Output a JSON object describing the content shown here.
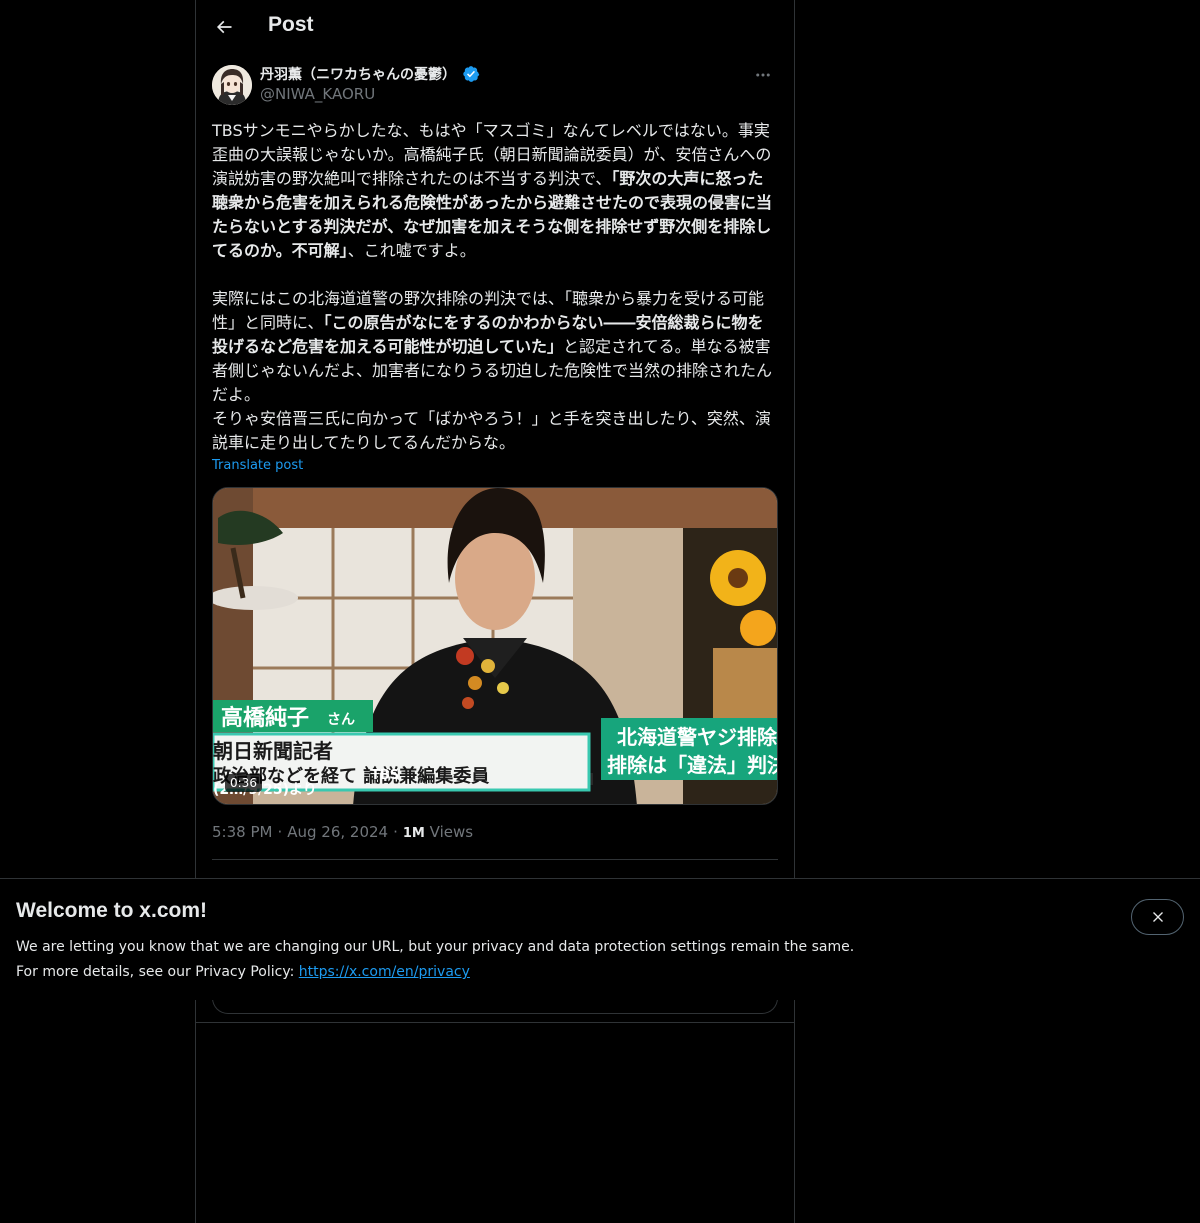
{
  "header": {
    "title": "Post"
  },
  "post": {
    "author": {
      "display_name": "丹羽薫（ニワカちゃんの憂鬱）",
      "handle": "@NIWA_KAORU"
    },
    "text_segments": [
      {
        "text": "TBSサンモニやらかしたな、もはや「マスゴミ」なんてレベルではない。事実歪曲の大誤報じゃないか。高橋純子氏（朝日新聞論説委員）が、安倍さんへの演説妨害の野次絶叫で排除されたのは不当する判決で、",
        "bold": false
      },
      {
        "text": "「野次の大声に怒った聴衆から危害を加えられる危険性があったから避難させたので表現の侵害に当たらないとする判決だが、なぜ加害を加えそうな側を排除せず野次側を排除してるのか。不可解」",
        "bold": true
      },
      {
        "text": "、これ嘘ですよ。\n\n実際にはこの北海道道警の野次排除の判決では、「聴衆から暴力を受ける可能性」と同時に、",
        "bold": false
      },
      {
        "text": "「この原告がなにをするのかわからない――安倍総裁らに物を投げるなど危害を加える可能性が切迫していた」",
        "bold": true
      },
      {
        "text": "と認定されてる。単なる被害者側じゃないんだよ、加害者になりうる切迫した危険性で当然の排除されたんだよ。\nそりゃ安倍晋三氏に向かって「ばかやろう！」と手を突き出したり、突然、演説車に走り出してたりしてるんだからな。",
        "bold": false
      }
    ],
    "translate_label": "Translate post",
    "media": {
      "duration": "0:36",
      "caption_name": "高橋純子",
      "caption_honorific": "さん",
      "caption_title": "朝日新聞記者",
      "caption_detail": "政治部などを経て 論説兼編集委員",
      "caption_source": "TBS",
      "caption_date": "(2…/9/25)より",
      "headline_line1": "北海道警ヤジ排除",
      "headline_line2": "排除は「違法」判決か"
    },
    "meta": {
      "time": "5:38 PM",
      "date": "Aug 26, 2024",
      "views_count": "1M",
      "views_label": "Views",
      "separator": "·"
    }
  },
  "banner": {
    "title": "Welcome to x.com!",
    "line1": "We are letting you know that we are changing our URL, but your privacy and data protection settings remain the same.",
    "line2_prefix": "For more details, see our Privacy Policy: ",
    "link": "https://x.com/en/privacy"
  },
  "icons": {
    "back": "arrow-left-icon",
    "verified": "verified-badge-icon",
    "more": "more-horizontal-icon",
    "close": "close-icon"
  },
  "colors": {
    "background": "#000000",
    "text": "#e7e9ea",
    "secondary": "#71767b",
    "accent": "#1d9bf0",
    "border": "#2f3336"
  }
}
